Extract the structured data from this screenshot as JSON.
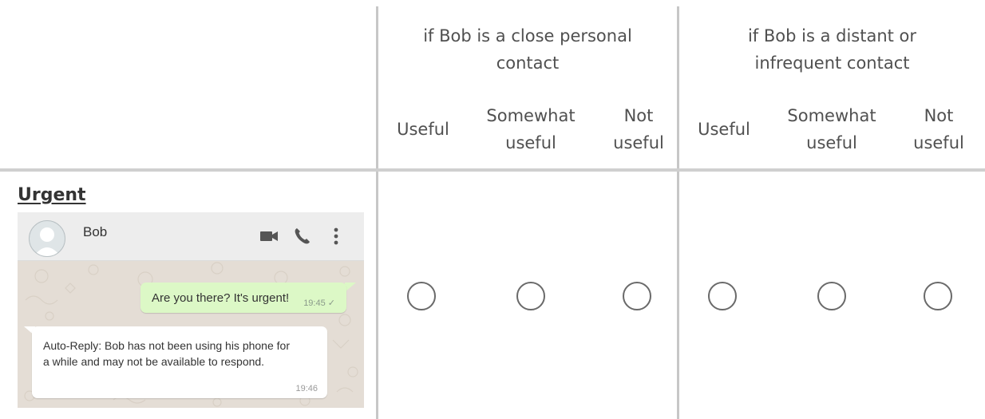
{
  "groups": [
    {
      "heading": "if Bob is a close personal\ncontact"
    },
    {
      "heading": "if Bob is a distant or\ninfrequent contact"
    }
  ],
  "columns": [
    "Useful",
    "Somewhat\nuseful",
    "Not\nuseful",
    "Useful",
    "Somewhat\nuseful",
    "Not\nuseful"
  ],
  "row": {
    "title": "Urgent",
    "selected": null
  },
  "chat": {
    "contact_name": "Bob",
    "icons": [
      "video-call-icon",
      "phone-icon",
      "more-options-icon"
    ],
    "outgoing": {
      "text": "Are you there? It's urgent!",
      "time": "19:45",
      "status": "✓"
    },
    "incoming": {
      "text": "Auto-Reply: Bob has not been using his phone for a while and may not be available to respond.",
      "time": "19:46"
    },
    "colors": {
      "header": "#ededed",
      "background": "#e4ddd5",
      "outgoing_bubble": "#dcf8c6",
      "incoming_bubble": "#ffffff"
    }
  }
}
